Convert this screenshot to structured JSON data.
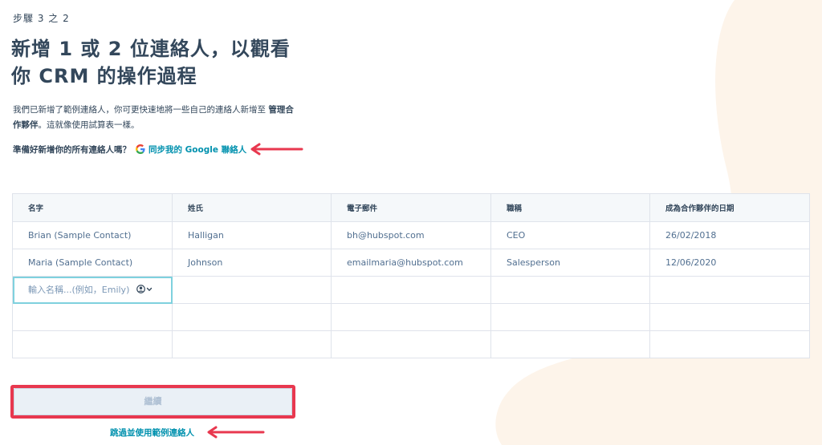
{
  "header": {
    "step": "步驟 3 之 2",
    "title_line1": "新增 1 或 2 位連絡人，以觀看",
    "title_line2": "你 CRM 的操作過程"
  },
  "description": {
    "text": "我們已新增了範例連絡人，你可更快速地將一些自己的連絡人新增至 ",
    "bold": "管理合作夥伴",
    "suffix": "。這就像使用試算表一樣。"
  },
  "sync": {
    "question": "準備好新增你的所有連絡人嗎？",
    "link": "同步我的 Google 聯絡人"
  },
  "table": {
    "headers": [
      "名字",
      "姓氏",
      "電子郵件",
      "職稱",
      "成為合作夥伴的日期"
    ],
    "rows": [
      [
        "Brian (Sample Contact)",
        "Halligan",
        "bh@hubspot.com",
        "CEO",
        "26/02/2018"
      ],
      [
        "Maria (Sample Contact)",
        "Johnson",
        "emailmaria@hubspot.com",
        "Salesperson",
        "12/06/2020"
      ]
    ],
    "input_placeholder": "輸入名稱...(例如，Emily)"
  },
  "actions": {
    "continue_label": "繼續",
    "skip_label": "跳過並使用範例連絡人"
  },
  "colors": {
    "accent_link": "#0091ae",
    "annotation_red": "#e8384f",
    "blob": "#fdf4ea"
  }
}
